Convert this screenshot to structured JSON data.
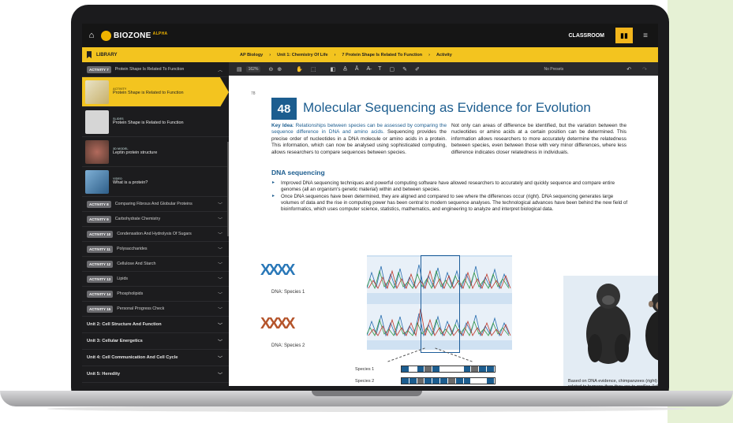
{
  "app": {
    "name": "BIOZONE",
    "suffix": "ALPHA",
    "classroom": "CLASSROOM"
  },
  "sidebar": {
    "library_label": "LIBRARY",
    "current_activity": {
      "badge": "ACTIVITY 7",
      "title": "Protein Shape Is Related To Function"
    },
    "resources": [
      {
        "tag": "ACTIVITY",
        "title": "Protein Shape is Related to Function"
      },
      {
        "tag": "SLIDES",
        "title": "Protein Shape is Related to Function"
      },
      {
        "tag": "3D MODEL",
        "title": "Leptin protein structure"
      },
      {
        "tag": "VIDEO",
        "title": "What is a protein?"
      }
    ],
    "activities": [
      {
        "badge": "ACTIVITY 8",
        "title": "Comparing Fibrous And Globular Proteins"
      },
      {
        "badge": "ACTIVITY 9",
        "title": "Carbohydrate Chemistry"
      },
      {
        "badge": "ACTIVITY 10",
        "title": "Condensation And Hydrolysis Of Sugars"
      },
      {
        "badge": "ACTIVITY 11",
        "title": "Polysaccharides"
      },
      {
        "badge": "ACTIVITY 12",
        "title": "Cellulose And Starch"
      },
      {
        "badge": "ACTIVITY 13",
        "title": "Lipids"
      },
      {
        "badge": "ACTIVITY 14",
        "title": "Phospholipids"
      },
      {
        "badge": "ACTIVITY 15",
        "title": "Personal Progress Check"
      }
    ],
    "units": [
      "Unit 2: Cell Structure And Function",
      "Unit 3: Cellular Energetics",
      "Unit 4: Cell Communication And Cell Cycle",
      "Unit 5: Heredity"
    ]
  },
  "breadcrumb": [
    "AP Biology",
    "Unit 1: Chemistry Of Life",
    "7 Protein Shape Is Related To Function",
    "Activity"
  ],
  "toolbar": {
    "zoom": "162%",
    "presets": "No Presets"
  },
  "page": {
    "page_number": "78",
    "activity_number": "48",
    "title": "Molecular Sequencing as Evidence for Evolution",
    "key_idea_label": "Key Idea",
    "key_idea": ": Relationships between species can be assessed by comparing the sequence difference in DNA and amino acids.",
    "left_text": "Sequencing provides the precise order of nucleotides in a DNA molecule or amino acids in a protein. This information, which can now be analysed using sophisticated computing, allows researchers to compare sequences between species.",
    "right_text": "Not only can areas of difference be identified, but the variation between the nucleotides or amino acids at a certain position can be determined. This information allows researchers to more accurately determine the relatedness between species, even between those with very minor differences, where less difference indicates closer relatedness in individuals.",
    "section_heading": "DNA sequencing",
    "bullets": [
      "Improved DNA sequencing techniques and powerful computing software have allowed researchers to accurately and quickly sequence and compare entire genomes (all an organism's genetic material) within and between species.",
      "Once DNA sequences have been determined, they are aligned and compared to see where the differences occur (right). DNA sequencing generates large volumes of data and the rise in computing power has been central to modern sequence analyses. The technological advances have been behind the new field of bioinformatics, which uses computer science, statistics, mathematics, and engineering to analyze and interpret biological data."
    ],
    "figure": {
      "dna_label_1": "DNA: Species 1",
      "dna_label_2": "DNA: Species 2",
      "species_1": "Species 1",
      "species_2": "Species 2",
      "caption": "Based on DNA evidence, chimpanzees (right) are more closely related to humans than they are to gorillas (left) and there is no genetic basis for the taxon, \"great apes\"."
    }
  }
}
